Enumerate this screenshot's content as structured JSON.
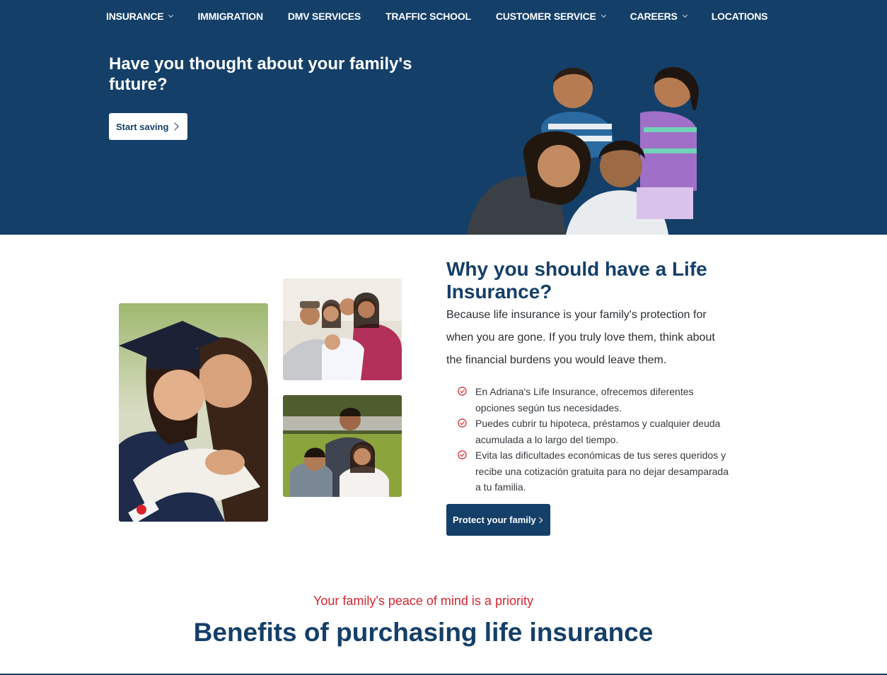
{
  "nav": {
    "items": [
      {
        "label": "INSURANCE",
        "dropdown": true
      },
      {
        "label": "IMMIGRATION",
        "dropdown": false
      },
      {
        "label": "DMV SERVICES",
        "dropdown": false
      },
      {
        "label": "TRAFFIC SCHOOL",
        "dropdown": false
      },
      {
        "label": "CUSTOMER SERVICE",
        "dropdown": true
      },
      {
        "label": "CAREERS",
        "dropdown": true
      },
      {
        "label": "LOCATIONS",
        "dropdown": false
      }
    ]
  },
  "hero": {
    "title": "Have you thought about your family's future?",
    "button_label": "Start saving"
  },
  "why": {
    "title": "Why you should have a Life Insurance?",
    "text": "Because life insurance is your family's protection for when you are gone. If you truly love them, think about the financial burdens you would leave them.",
    "benefits": [
      "En Adriana's Life Insurance, ofrecemos diferentes opciones según tus necesidades.",
      "Puedes cubrir tu hipoteca, préstamos y cualquier deuda acumulada a lo largo del tiempo.",
      "Evita las dificultades económicas de tus seres queridos y recibe una cotización gratuita para no dejar desamparada a tu familia."
    ],
    "button_label": "Protect your family"
  },
  "benefits": {
    "subtitle": "Your family's peace of mind is a priority",
    "title": "Benefits of purchasing life insurance"
  },
  "colors": {
    "brand_navy": "#143f68",
    "accent_red": "#d3272e",
    "white": "#ffffff"
  },
  "icons": {
    "dropdown": "chevron-down-icon",
    "button_arrow": "chevron-right-icon",
    "list_bullet": "check-circle-icon"
  }
}
